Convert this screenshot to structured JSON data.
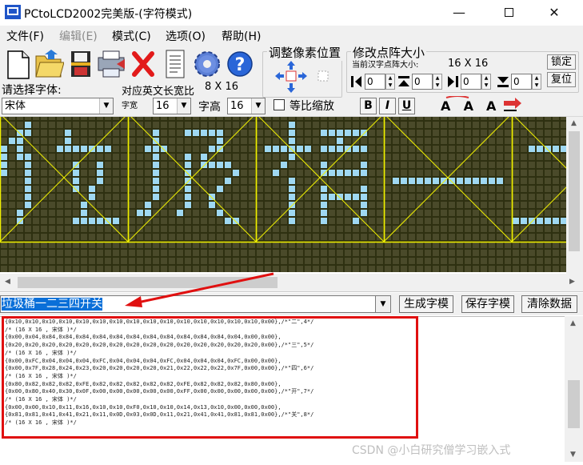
{
  "window": {
    "title": "PCtoLCD2002完美版-(字符模式)",
    "minimize_glyph": "—",
    "close_glyph": "✕"
  },
  "menu": [
    {
      "label": "文件(F)",
      "enabled": true
    },
    {
      "label": "编辑(E)",
      "enabled": false
    },
    {
      "label": "模式(C)",
      "enabled": true
    },
    {
      "label": "选项(O)",
      "enabled": true
    },
    {
      "label": "帮助(H)",
      "enabled": true
    }
  ],
  "toolbar": {
    "icons": [
      "new-file-icon",
      "open-folder-icon",
      "save-disk-icon",
      "print-icon",
      "delete-x-icon",
      "notepad-icon",
      "gear-icon",
      "help-icon"
    ],
    "adjust_group_title": "调整像素位置",
    "matrix_group_title": "修改点阵大小",
    "current_size_label": "当前汉字点阵大小:",
    "current_size_value": "16 X 16",
    "lock_button": "锁定",
    "reset_button": "复位",
    "spin_values": [
      "0",
      "0",
      "0",
      "0"
    ],
    "font_label": "请选择字体:",
    "font_value": "宋体",
    "ascii_ratio_label": "对应英文长宽比",
    "ascii_ratio_value": "8 X 16",
    "char_width_label": "字宽",
    "char_width_value": "16",
    "char_height_label": "字高",
    "char_height_value": "16",
    "scale_checkbox_label": "等比缩放",
    "bold_label": "B",
    "italic_label": "I",
    "underline_label": "U"
  },
  "matrix": {
    "grid_color": "#2e3011",
    "dot_color": "#9fd8f2",
    "guide_color": "#f0f000",
    "visible_chars": [
      "垃",
      "圾",
      "桶",
      "一",
      "二"
    ]
  },
  "input_row": {
    "text": "垃圾桶一二三四开关",
    "generate_button": "生成字模",
    "save_button": "保存字模",
    "clear_button": "清除数据"
  },
  "output_lines": [
    "{0x10,0x10,0x10,0x10,0x10,0x10,0x10,0x10,0x10,0x10,0x10,0x10,0x10,0x10,0x10,0x00},/*\"二\",4*/",
    "/* (16 X 16 , 宋体 )*/",
    "{0x00,0x04,0x84,0x84,0x84,0x84,0x84,0x84,0x84,0x84,0x84,0x84,0x84,0x04,0x00,0x00},",
    "{0x20,0x20,0x20,0x20,0x20,0x20,0x20,0x20,0x20,0x20,0x20,0x20,0x20,0x20,0x20,0x00},/*\"三\",5*/",
    "/* (16 X 16 , 宋体 )*/",
    "{0x00,0xFC,0x04,0x04,0x04,0xFC,0x04,0x04,0x04,0xFC,0x04,0x04,0x04,0xFC,0x00,0x00},",
    "{0x00,0x7F,0x28,0x24,0x23,0x20,0x20,0x20,0x20,0x21,0x22,0x22,0x22,0x7F,0x00,0x00},/*\"四\",6*/",
    "/* (16 X 16 , 宋体 )*/",
    "{0x80,0x82,0x82,0x82,0xFE,0x82,0x82,0x82,0x82,0x82,0xFE,0x82,0x82,0x82,0x80,0x00},",
    "{0x00,0x80,0x40,0x30,0x0F,0x00,0x00,0x00,0x00,0x00,0xFF,0x00,0x00,0x00,0x00,0x00},/*\"开\",7*/",
    "/* (16 X 16 , 宋体 )*/",
    "{0x00,0x00,0x10,0x11,0x16,0x10,0x10,0xF0,0x10,0x10,0x14,0x13,0x10,0x00,0x00,0x00},",
    "{0x81,0x81,0x41,0x41,0x21,0x11,0x0D,0x03,0x0D,0x11,0x21,0x41,0x41,0x81,0x81,0x00},/*\"关\",8*/",
    "/* (16 X 16 , 宋体 )*/"
  ],
  "colors": {
    "highlight": "#0a6fd8",
    "annotation_red": "#e01010"
  },
  "watermark": "CSDN @小白研究僧学习嵌入式"
}
